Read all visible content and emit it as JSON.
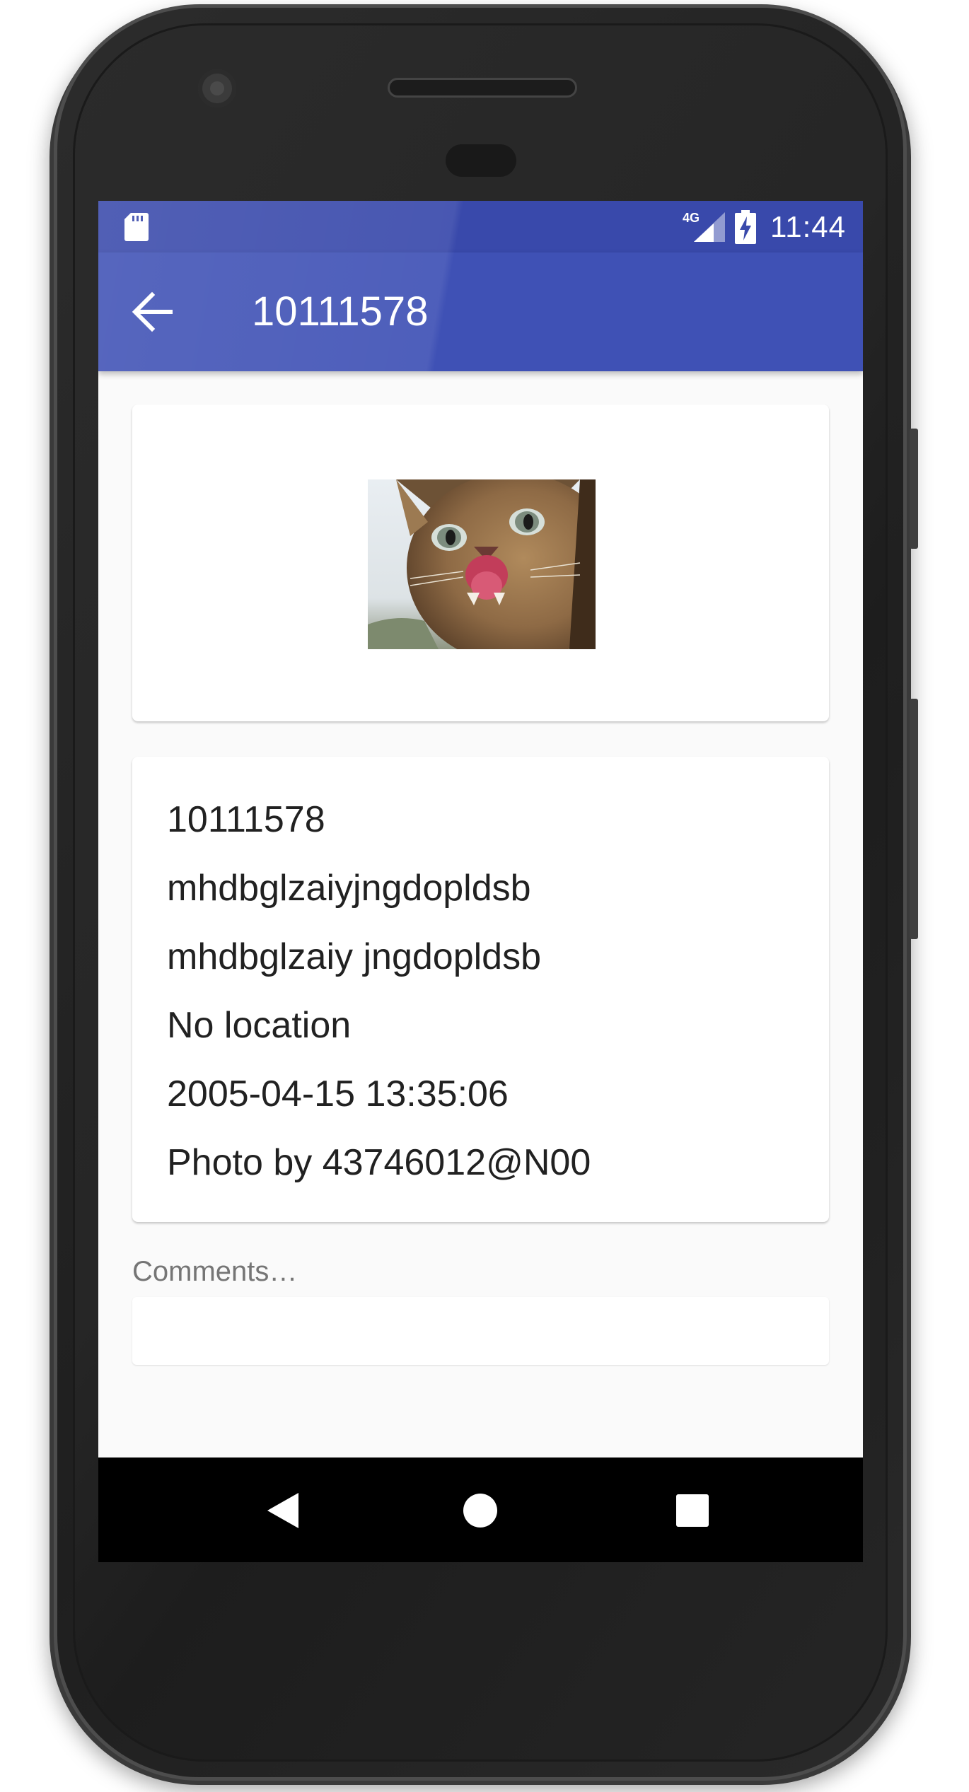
{
  "status_bar": {
    "time": "11:44",
    "network_label": "4G",
    "icons": [
      "sd-card-icon",
      "signal-icon",
      "battery-charging-icon"
    ]
  },
  "app_bar": {
    "title": "10111578",
    "back_icon": "arrow-back-icon"
  },
  "photo": {
    "subject": "cat"
  },
  "details": {
    "id": "10111578",
    "title": "mhdbglzaiyjngdopldsb",
    "description": "mhdbglzaiy jngdopldsb",
    "location": "No location",
    "date_taken": "2005-04-15 13:35:06",
    "owner": "Photo by 43746012@N00"
  },
  "comments": {
    "label": "Comments…",
    "value": ""
  },
  "nav_bar": {
    "icons": [
      "back-triangle-icon",
      "home-circle-icon",
      "recents-square-icon"
    ]
  },
  "colors": {
    "status_bar": "#3949ab",
    "app_bar": "#3f51b5",
    "background": "#fafafa",
    "card": "#ffffff",
    "primary_text": "#212121",
    "secondary_text": "#757575"
  }
}
